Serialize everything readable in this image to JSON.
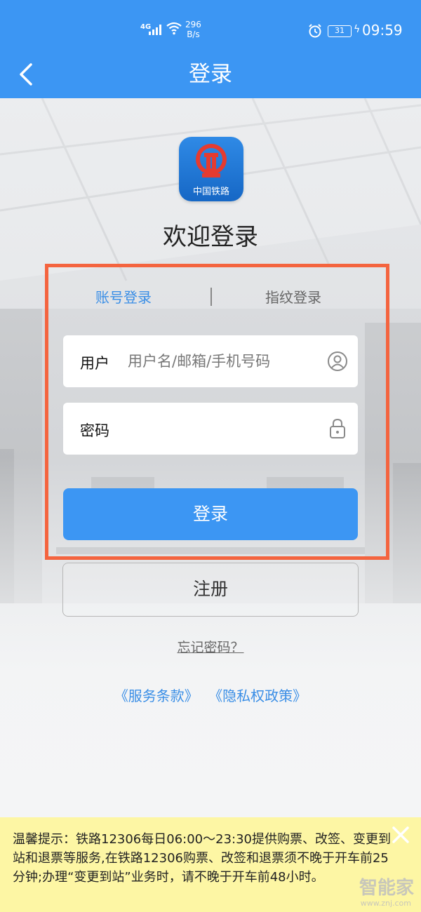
{
  "status_bar": {
    "network": "4G",
    "speed_value": "296",
    "speed_unit": "B/s",
    "battery": "31",
    "time": "09:59"
  },
  "header": {
    "title": "登录",
    "color": "#3c96f3"
  },
  "logo": {
    "text": "中国铁路"
  },
  "welcome": "欢迎登录",
  "tabs": [
    {
      "label": "账号登录",
      "active": true
    },
    {
      "label": "指纹登录",
      "active": false
    }
  ],
  "form": {
    "user_label": "用户",
    "user_placeholder": "用户名/邮箱/手机号码",
    "user_value": "",
    "password_label": "密码",
    "password_value": "",
    "login_button": "登录",
    "register_button": "注册",
    "forgot_link": "忘记密码？"
  },
  "links": {
    "terms": "《服务条款》",
    "privacy": "《隐私权政策》"
  },
  "notice": {
    "text": "温馨提示：铁路12306每日06:00～23:30提供购票、改签、变更到站和退票等服务,在铁路12306购票、改签和退票须不晚于开车前25分钟;办理“变更到站”业务时，请不晚于开车前48小时。"
  },
  "watermark": {
    "text": "智能家",
    "url": "www.znj.com"
  },
  "colors": {
    "accent": "#3c96f3",
    "highlight_border": "#f4643f",
    "notice_bg": "#fdf6a4"
  }
}
